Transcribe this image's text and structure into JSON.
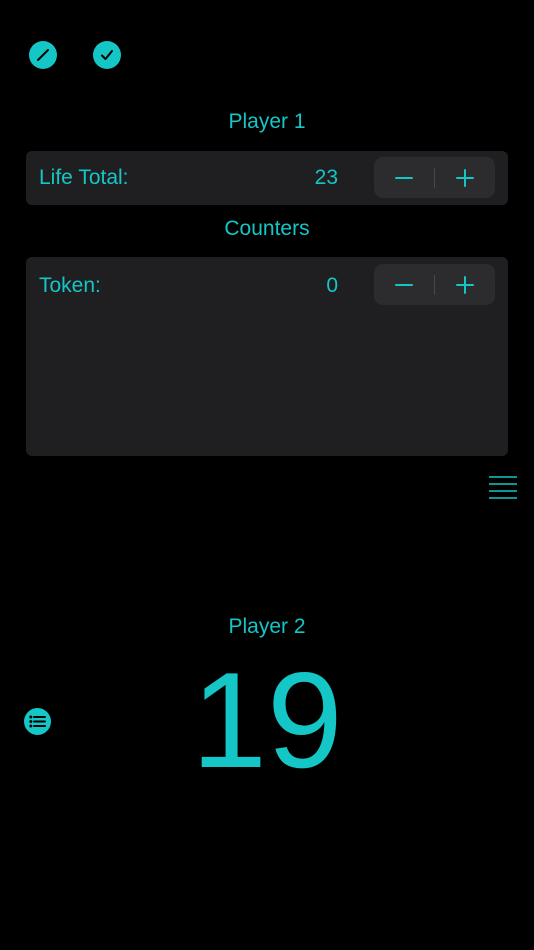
{
  "toolbar": {
    "edit_icon": "pencil-icon",
    "done_icon": "checkmark-icon"
  },
  "player1": {
    "name": "Player 1",
    "life_label": "Life Total:",
    "life_value": "23",
    "counters_heading": "Counters",
    "counters": [
      {
        "label": "Token:",
        "value": "0"
      }
    ]
  },
  "player2": {
    "name": "Player 2",
    "life_value": "19",
    "list_icon": "list-icon"
  },
  "stepper": {
    "minus_icon": "minus-icon",
    "plus_icon": "plus-icon"
  },
  "menu_icon": "hamburger-menu-icon",
  "colors": {
    "accent": "#15c6c6",
    "background": "#000000",
    "panel": "#1f1f21",
    "stepper": "#2c2c2e"
  }
}
